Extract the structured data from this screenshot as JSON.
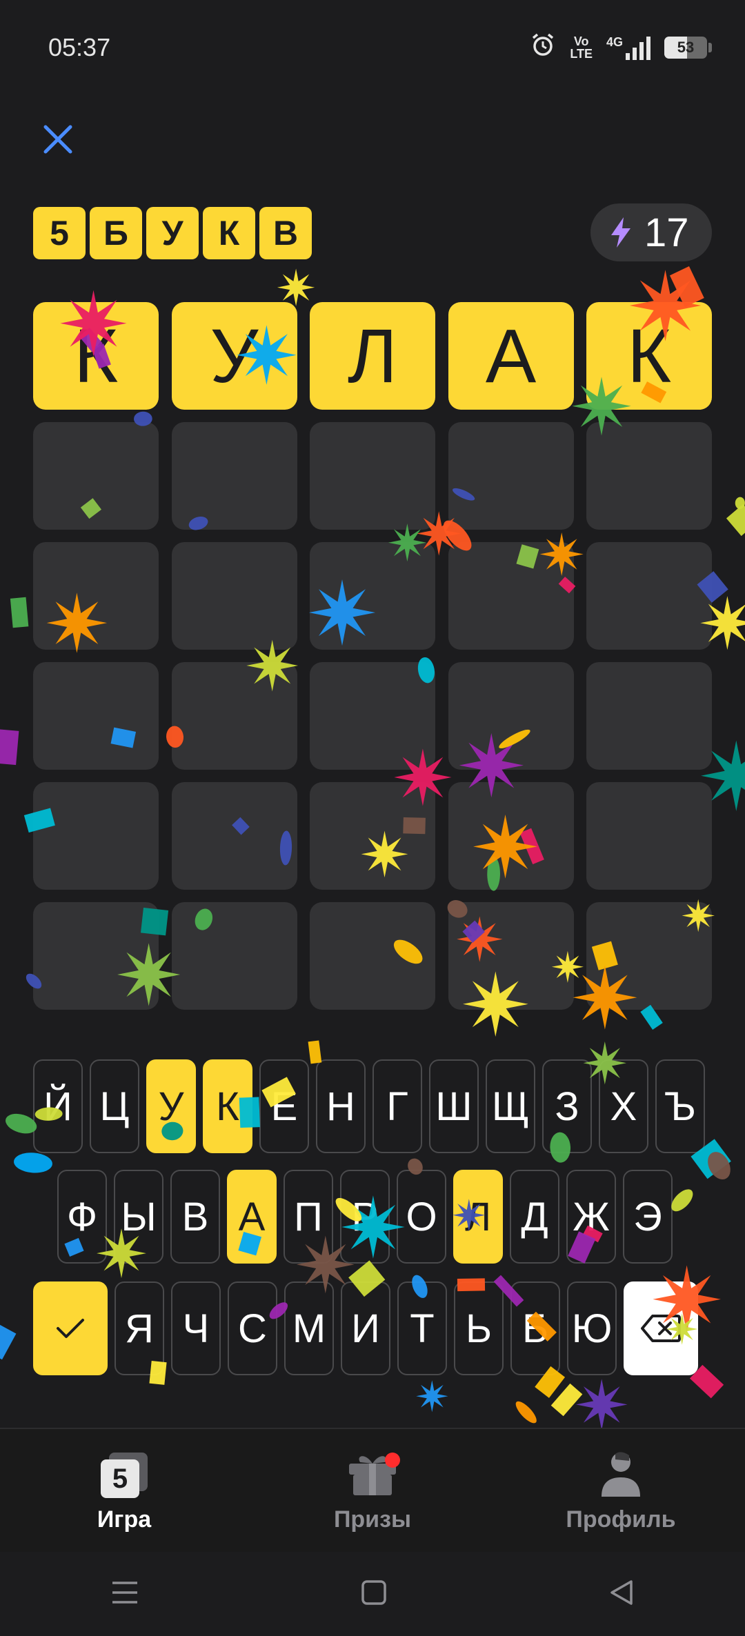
{
  "status_bar": {
    "time": "05:37",
    "network_label": "4G",
    "volte_line1": "Vo",
    "volte_line2": "LTE",
    "battery": "53",
    "battery_level": 0.53
  },
  "logo_letters": [
    "5",
    "Б",
    "У",
    "К",
    "В"
  ],
  "energy": {
    "count": "17"
  },
  "board": {
    "rows": [
      [
        {
          "letter": "К",
          "state": "correct"
        },
        {
          "letter": "У",
          "state": "correct"
        },
        {
          "letter": "Л",
          "state": "correct"
        },
        {
          "letter": "А",
          "state": "correct"
        },
        {
          "letter": "К",
          "state": "correct"
        }
      ],
      [
        {
          "letter": "",
          "state": "empty"
        },
        {
          "letter": "",
          "state": "empty"
        },
        {
          "letter": "",
          "state": "empty"
        },
        {
          "letter": "",
          "state": "empty"
        },
        {
          "letter": "",
          "state": "empty"
        }
      ],
      [
        {
          "letter": "",
          "state": "empty"
        },
        {
          "letter": "",
          "state": "empty"
        },
        {
          "letter": "",
          "state": "empty"
        },
        {
          "letter": "",
          "state": "empty"
        },
        {
          "letter": "",
          "state": "empty"
        }
      ],
      [
        {
          "letter": "",
          "state": "empty"
        },
        {
          "letter": "",
          "state": "empty"
        },
        {
          "letter": "",
          "state": "empty"
        },
        {
          "letter": "",
          "state": "empty"
        },
        {
          "letter": "",
          "state": "empty"
        }
      ],
      [
        {
          "letter": "",
          "state": "empty"
        },
        {
          "letter": "",
          "state": "empty"
        },
        {
          "letter": "",
          "state": "empty"
        },
        {
          "letter": "",
          "state": "empty"
        },
        {
          "letter": "",
          "state": "empty"
        }
      ],
      [
        {
          "letter": "",
          "state": "empty"
        },
        {
          "letter": "",
          "state": "empty"
        },
        {
          "letter": "",
          "state": "empty"
        },
        {
          "letter": "",
          "state": "empty"
        },
        {
          "letter": "",
          "state": "empty"
        }
      ]
    ]
  },
  "keyboard": {
    "row1": [
      "Й",
      "Ц",
      "У",
      "К",
      "Е",
      "Н",
      "Г",
      "Ш",
      "Щ",
      "З",
      "Х",
      "Ъ"
    ],
    "row2": [
      "Ф",
      "Ы",
      "В",
      "А",
      "П",
      "Р",
      "О",
      "Л",
      "Д",
      "Ж",
      "Э"
    ],
    "row3": [
      "Я",
      "Ч",
      "С",
      "М",
      "И",
      "Т",
      "Ь",
      "Б",
      "Ю"
    ],
    "highlighted": [
      "У",
      "К",
      "А",
      "Л"
    ]
  },
  "nav": {
    "game": "Игра",
    "prizes": "Призы",
    "profile": "Профиль",
    "game_badge": "5"
  },
  "colors": {
    "accent": "#fdd835",
    "tile_empty": "#333335",
    "background": "#1c1c1e",
    "notification": "#ff2d2d"
  },
  "icons": [
    "close-icon",
    "alarm-icon",
    "lightning-icon",
    "check-icon",
    "backspace-icon",
    "gift-icon",
    "profile-icon",
    "menu-icon",
    "home-icon",
    "back-icon"
  ]
}
